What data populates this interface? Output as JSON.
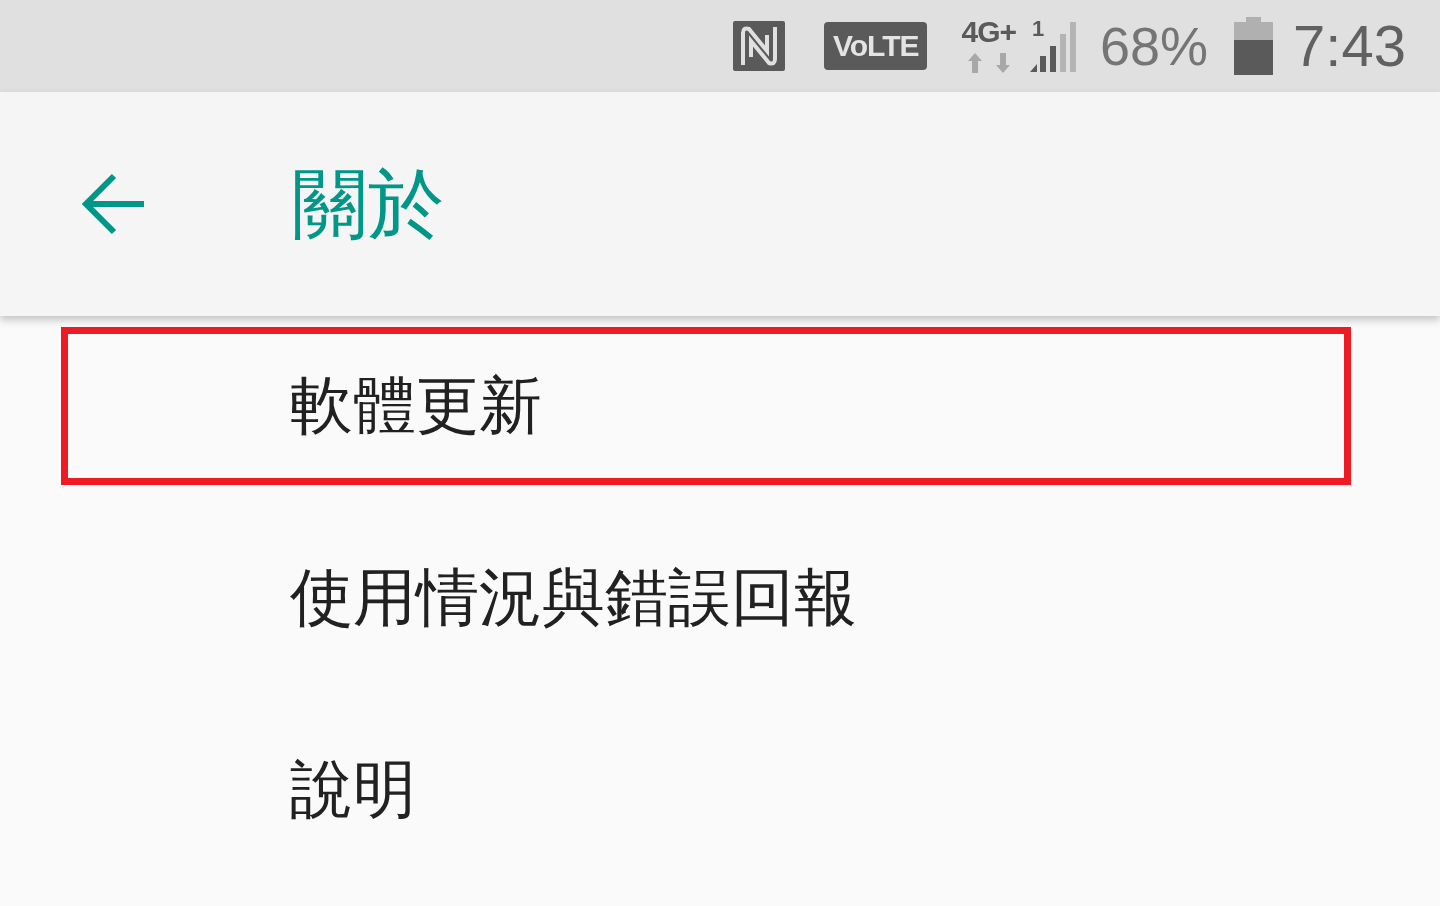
{
  "status_bar": {
    "volte": "VoLTE",
    "network_type": "4G+",
    "sim_slot": "1",
    "battery_percent": "68%",
    "time": "7:43"
  },
  "app_bar": {
    "title": "關於"
  },
  "items": [
    {
      "label": "軟體更新",
      "highlighted": true
    },
    {
      "label": "使用情況與錯誤回報",
      "highlighted": false
    },
    {
      "label": "說明",
      "highlighted": false
    }
  ]
}
